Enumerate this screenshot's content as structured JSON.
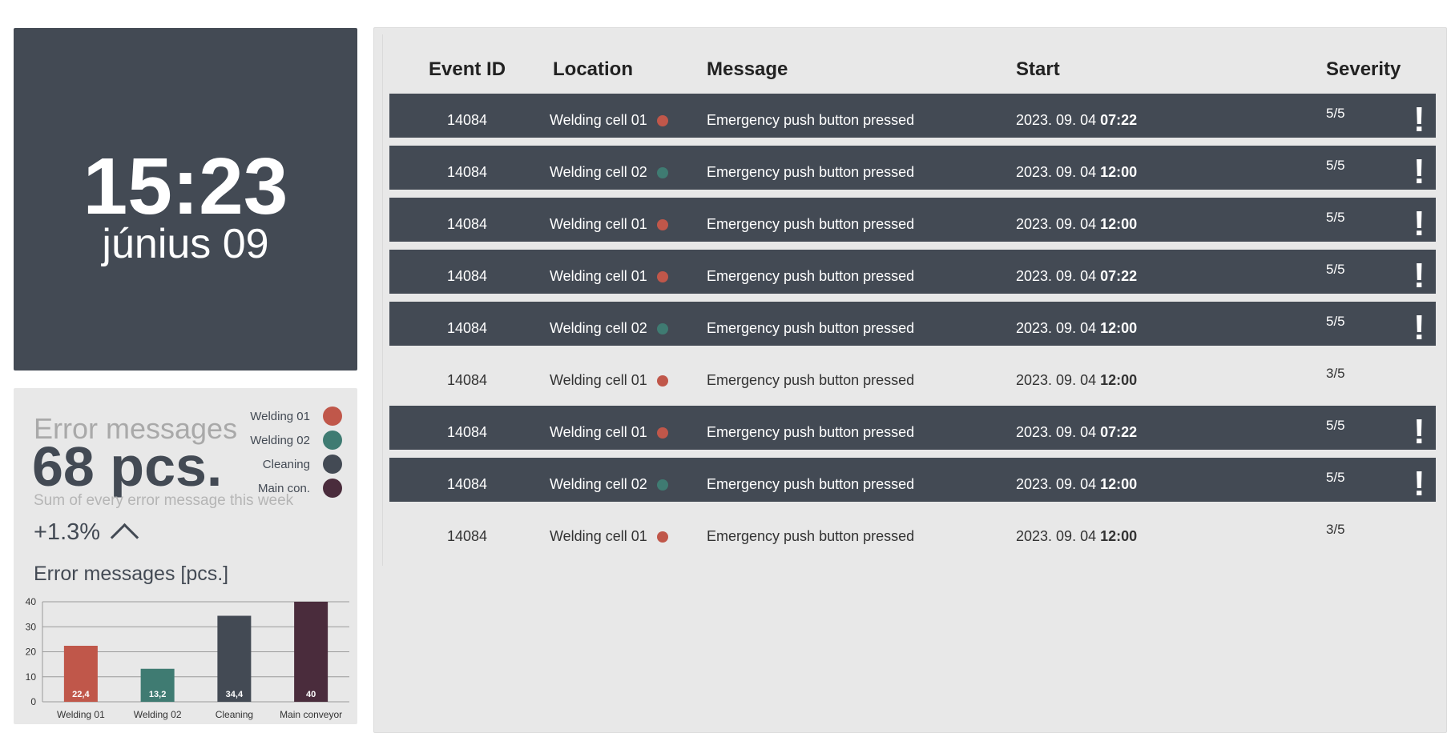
{
  "clock": {
    "time": "15:23",
    "date": "június 09"
  },
  "stats": {
    "title": "Error messages",
    "count": "68 pcs.",
    "subtitle": "Sum of every error message this week",
    "trend": "+1.3%"
  },
  "legend": [
    {
      "label": "Welding 01",
      "color": "#c0574a"
    },
    {
      "label": "Welding 02",
      "color": "#3f7b72"
    },
    {
      "label": "Cleaning",
      "color": "#434a54"
    },
    {
      "label": "Main con.",
      "color": "#4a2c3c"
    }
  ],
  "chart_data": {
    "type": "bar",
    "title": "Error messages [pcs.]",
    "categories": [
      "Welding 01",
      "Welding 02",
      "Cleaning",
      "Main conveyor"
    ],
    "values": [
      22.4,
      13.2,
      34.4,
      40
    ],
    "value_labels": [
      "22,4",
      "13,2",
      "34,4",
      "40"
    ],
    "colors": [
      "#c0574a",
      "#3f7b72",
      "#434a54",
      "#4a2c3c"
    ],
    "ylim": [
      0,
      40
    ],
    "yticks": [
      0,
      10,
      20,
      30,
      40
    ],
    "grid": true
  },
  "table": {
    "headers": [
      "Event ID",
      "Location",
      "Message",
      "Start",
      "Severity"
    ],
    "rows": [
      {
        "id": "14084",
        "location": "Welding cell 01",
        "dot": "#c0574a",
        "message": "Emergency push button pressed",
        "date": "2023. 09. 04",
        "time": "07:22",
        "severity": "5/5",
        "alert": "!",
        "dark": true
      },
      {
        "id": "14084",
        "location": "Welding cell 02",
        "dot": "#3f7b72",
        "message": "Emergency push button pressed",
        "date": "2023. 09. 04",
        "time": "12:00",
        "severity": "5/5",
        "alert": "!",
        "dark": true
      },
      {
        "id": "14084",
        "location": "Welding cell 01",
        "dot": "#c0574a",
        "message": "Emergency push button pressed",
        "date": "2023. 09. 04",
        "time": "12:00",
        "severity": "5/5",
        "alert": "!",
        "dark": true
      },
      {
        "id": "14084",
        "location": "Welding cell 01",
        "dot": "#c0574a",
        "message": "Emergency push button pressed",
        "date": "2023. 09. 04",
        "time": "07:22",
        "severity": "5/5",
        "alert": "!",
        "dark": true
      },
      {
        "id": "14084",
        "location": "Welding cell 02",
        "dot": "#3f7b72",
        "message": "Emergency push button pressed",
        "date": "2023. 09. 04",
        "time": "12:00",
        "severity": "5/5",
        "alert": "!",
        "dark": true
      },
      {
        "id": "14084",
        "location": "Welding cell 01",
        "dot": "#c0574a",
        "message": "Emergency push button pressed",
        "date": "2023. 09. 04",
        "time": "12:00",
        "severity": "3/5",
        "alert": "",
        "dark": false
      },
      {
        "id": "14084",
        "location": "Welding cell 01",
        "dot": "#c0574a",
        "message": "Emergency push button pressed",
        "date": "2023. 09. 04",
        "time": "07:22",
        "severity": "5/5",
        "alert": "!",
        "dark": true
      },
      {
        "id": "14084",
        "location": "Welding cell 02",
        "dot": "#3f7b72",
        "message": "Emergency push button pressed",
        "date": "2023. 09. 04",
        "time": "12:00",
        "severity": "5/5",
        "alert": "!",
        "dark": true
      },
      {
        "id": "14084",
        "location": "Welding cell 01",
        "dot": "#c0574a",
        "message": "Emergency push button pressed",
        "date": "2023. 09. 04",
        "time": "12:00",
        "severity": "3/5",
        "alert": "",
        "dark": false
      }
    ]
  }
}
